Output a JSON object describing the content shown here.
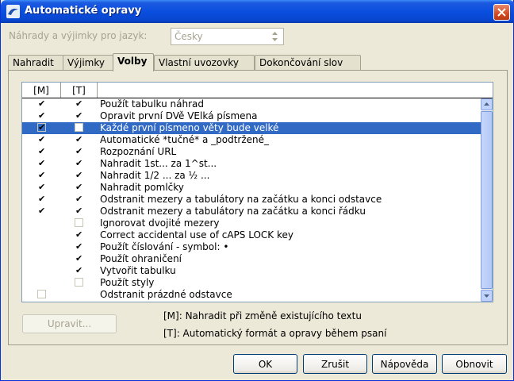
{
  "window": {
    "title": "Automatické opravy",
    "icon": "openoffice-gull-icon"
  },
  "language": {
    "label": "Náhrady a výjimky pro jazyk:",
    "value": "Česky"
  },
  "tabs": [
    {
      "label": "Nahradit",
      "active": false
    },
    {
      "label": "Výjimky",
      "active": false
    },
    {
      "label": "Volby",
      "active": true
    },
    {
      "label": "Vlastní uvozovky",
      "active": false
    },
    {
      "label": "Dokončování slov",
      "active": false
    }
  ],
  "list": {
    "headers": [
      "[M]",
      "[T]"
    ],
    "rows": [
      {
        "m": true,
        "t": true,
        "label": "Použít tabulku náhrad",
        "selected": false
      },
      {
        "m": true,
        "t": true,
        "label": "Opravit první DVě VElká písmena",
        "selected": false
      },
      {
        "m": true,
        "t": false,
        "label": "Každé první písmeno věty bude velké",
        "selected": true
      },
      {
        "m": true,
        "t": true,
        "label": "Automatické *tučné* a _podtržené_",
        "selected": false
      },
      {
        "m": true,
        "t": true,
        "label": "Rozpoznání URL",
        "selected": false
      },
      {
        "m": true,
        "t": true,
        "label": "Nahradit 1st... za 1^st...",
        "selected": false
      },
      {
        "m": true,
        "t": true,
        "label": "Nahradit 1/2 ... za ½ ...",
        "selected": false
      },
      {
        "m": true,
        "t": true,
        "label": "Nahradit pomlčky",
        "selected": false
      },
      {
        "m": true,
        "t": true,
        "label": "Odstranit mezery a tabulátory na začátku a konci odstavce",
        "selected": false
      },
      {
        "m": true,
        "t": true,
        "label": "Odstranit mezery a tabulátory na začátku a konci řádku",
        "selected": false
      },
      {
        "m": null,
        "t": false,
        "label": "Ignorovat dvojité mezery",
        "selected": false
      },
      {
        "m": null,
        "t": true,
        "label": "Correct accidental use of cAPS LOCK key",
        "selected": false
      },
      {
        "m": null,
        "t": true,
        "label": "Použít číslování - symbol: •",
        "selected": false
      },
      {
        "m": null,
        "t": true,
        "label": "Použít ohraničení",
        "selected": false
      },
      {
        "m": null,
        "t": true,
        "label": "Vytvořit tabulku",
        "selected": false
      },
      {
        "m": null,
        "t": false,
        "label": "Použít styly",
        "selected": false
      },
      {
        "m": false,
        "t": null,
        "label": "Odstranit prázdné odstavce",
        "selected": false
      }
    ]
  },
  "edit_button": "Upravit...",
  "legend": {
    "m": "[M]: Nahradit při změně existujícího textu",
    "t": "[T]: Automatický formát a opravy během psaní"
  },
  "buttons": {
    "ok": "OK",
    "cancel": "Zrušit",
    "help": "Nápověda",
    "reset": "Obnovit"
  }
}
